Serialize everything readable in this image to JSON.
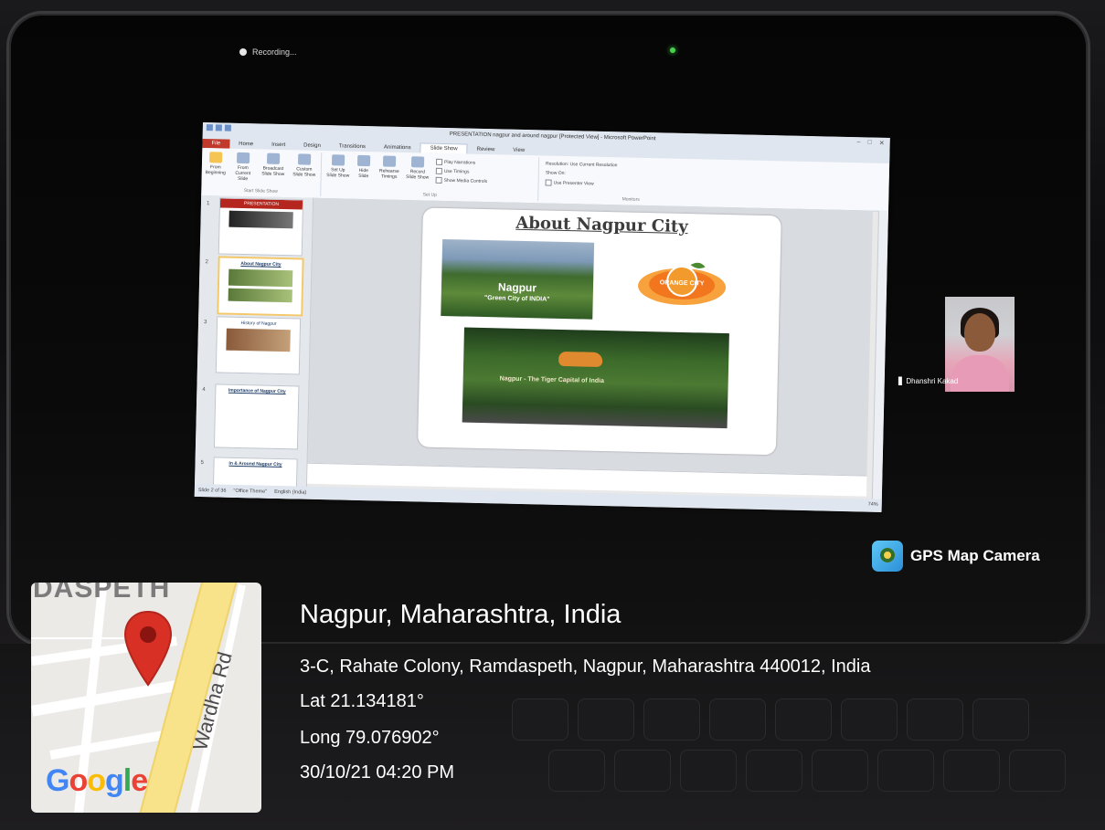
{
  "recording": {
    "label": "Recording..."
  },
  "powerpoint": {
    "window_title": "PRESENTATION nagpur and around nagpur [Protected View] - Microsoft PowerPoint",
    "tabs": [
      {
        "label": "File"
      },
      {
        "label": "Home"
      },
      {
        "label": "Insert"
      },
      {
        "label": "Design"
      },
      {
        "label": "Transitions"
      },
      {
        "label": "Animations"
      },
      {
        "label": "Slide Show"
      },
      {
        "label": "Review"
      },
      {
        "label": "View"
      }
    ],
    "ribbon": {
      "from_beginning": "From Beginning",
      "from_current": "From Current Slide",
      "broadcast": "Broadcast Slide Show",
      "custom": "Custom Slide Show",
      "group_start": "Start Slide Show",
      "setup": "Set Up Slide Show",
      "hide_slide": "Hide Slide",
      "rehearse": "Rehearse Timings",
      "record": "Record Slide Show",
      "play_narrations": "Play Narrations",
      "use_timings": "Use Timings",
      "show_media": "Show Media Controls",
      "group_setup": "Set Up",
      "resolution_label": "Resolution:",
      "resolution_value": "Use Current Resolution",
      "show_on": "Show On:",
      "presenter_view": "Use Presenter View",
      "group_monitors": "Monitors"
    },
    "thumbnails": [
      {
        "num": "1",
        "title": "PRESENTATION"
      },
      {
        "num": "2",
        "title": "About Nagpur City"
      },
      {
        "num": "3",
        "title": "History of Nagpur"
      },
      {
        "num": "4",
        "title": "Importance of Nagpur City"
      },
      {
        "num": "5",
        "title": "In & Around Nagpur City"
      }
    ],
    "slide": {
      "title": "About Nagpur City",
      "img1_caption": "Nagpur",
      "img1_subcaption": "\"Green City of INDIA\"",
      "logo_text": "ORANGE CITY",
      "img2_caption": "Nagpur - The Tiger Capital of India"
    },
    "status": {
      "slide_info": "Slide 2 of 36",
      "theme": "\"Office Theme\"",
      "language": "English (India)",
      "zoom": "74%"
    }
  },
  "participant": {
    "name": "Dhanshri Kakad"
  },
  "gps": {
    "app_name": "GPS Map Camera",
    "map_area_label": "DASPETH",
    "map_road_label": "Wardha Rd",
    "map_logo": "Google",
    "location": "Nagpur, Maharashtra, India",
    "address": "3-C, Rahate Colony, Ramdaspeth, Nagpur, Maharashtra 440012, India",
    "lat": "Lat 21.134181°",
    "long": "Long 79.076902°",
    "datetime": "30/10/21 04:20 PM"
  },
  "colors": {
    "google_blue": "#4285F4",
    "google_red": "#EA4335",
    "google_yellow": "#FBBC05",
    "google_green": "#34A853",
    "pin_red": "#d93025"
  }
}
